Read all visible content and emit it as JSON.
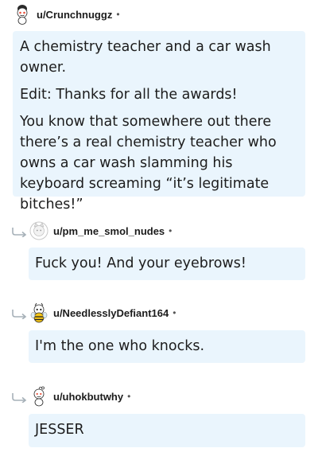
{
  "comments": [
    {
      "username": "u/Crunchnuggz",
      "separator": "•",
      "avatar_icon": "snoo-dark-hair-icon",
      "paragraphs": [
        "A chemistry teacher and a car wash owner.",
        "Edit: Thanks for all the awards!",
        "You know that somewhere out there there’s a real chemistry teacher who owns a car wash slamming his keyboard screaming “it’s legitimate bitches!”"
      ]
    },
    {
      "username": "u/pm_me_smol_nudes",
      "separator": "•",
      "avatar_icon": "cat-avatar-icon",
      "paragraphs": [
        "Fuck you! And your eyebrows!"
      ]
    },
    {
      "username": "u/NeedlesslyDefiant164",
      "separator": "•",
      "avatar_icon": "bee-snoo-icon",
      "paragraphs": [
        "I'm the one who knocks."
      ]
    },
    {
      "username": "u/uhokbutwhy",
      "separator": "•",
      "avatar_icon": "snoo-icon",
      "paragraphs": [
        "JESSER"
      ]
    }
  ],
  "colors": {
    "bubble_bg": "#eaf5fd",
    "text": "#1c1c1c",
    "reply_arrow": "#a6b0b8"
  },
  "reply_icon": "reply-arrow-icon"
}
